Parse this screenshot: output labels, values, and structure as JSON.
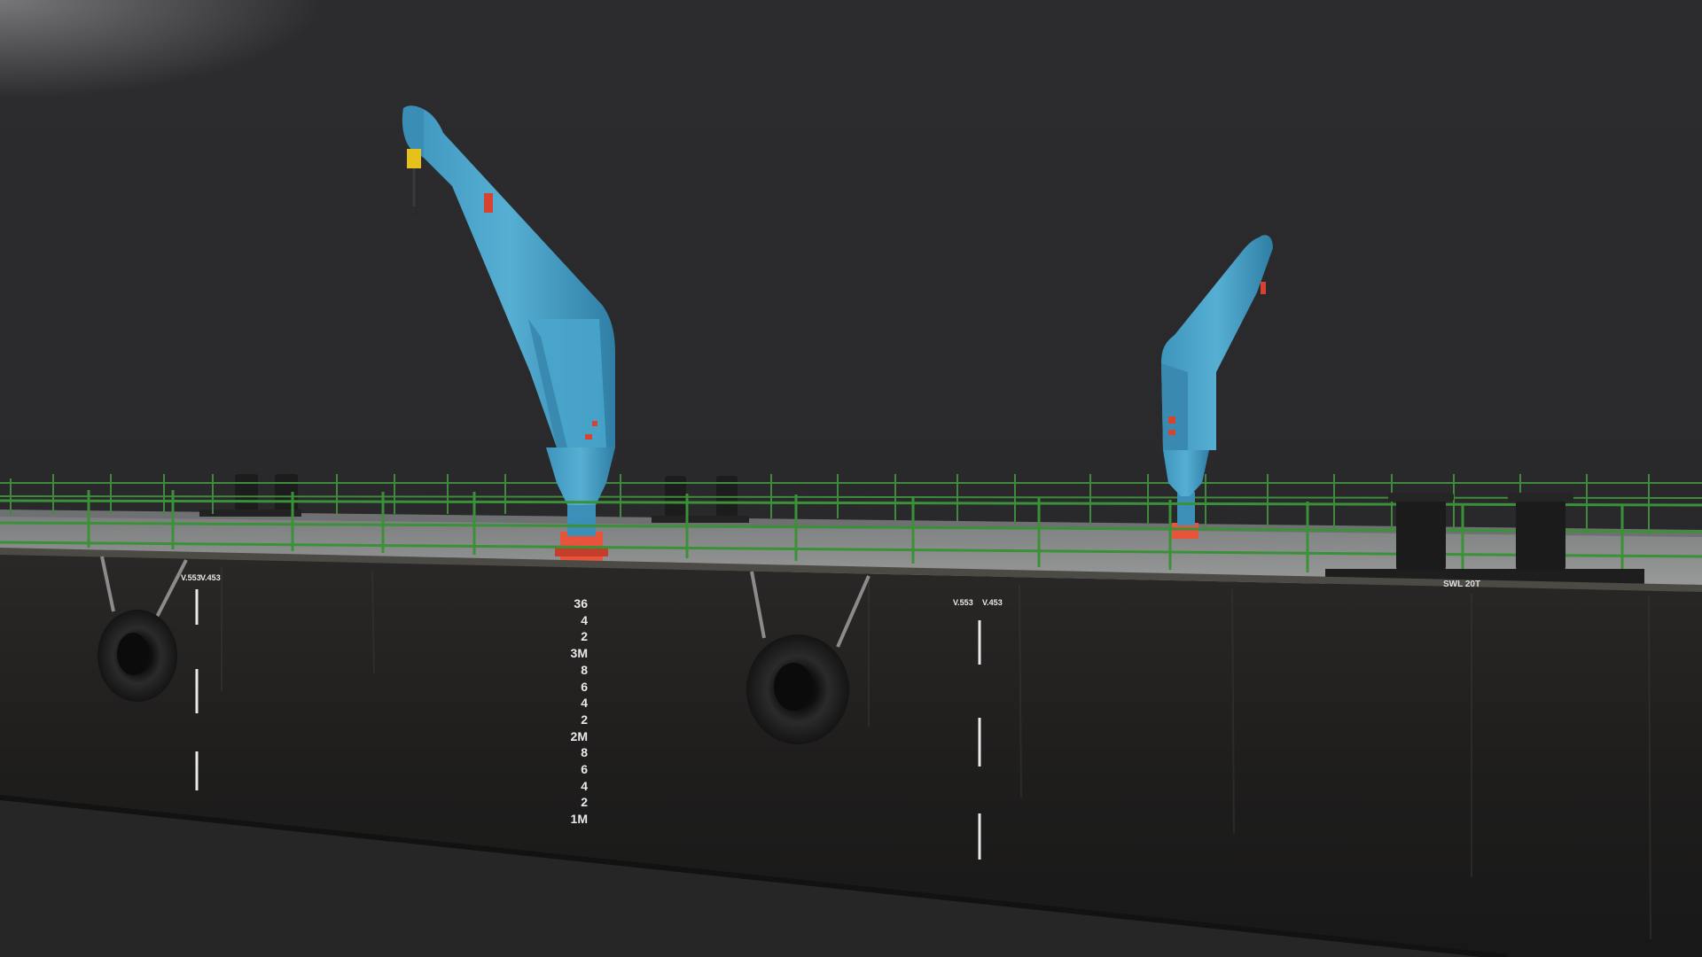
{
  "scene": {
    "subject": "barge-with-two-cranes",
    "colors": {
      "background": "#2a2a2b",
      "hull": "#1f1e1d",
      "deck": "#8e8f8f",
      "crane": "#4ba3c9",
      "crane_base": "#e8533b",
      "railing": "#3f8a3c"
    }
  },
  "hull_marks": {
    "mark_left": {
      "v1": "V.553",
      "v2": "V.453"
    },
    "mark_center": {
      "v1": "V.553",
      "v2": "V.453"
    },
    "draft_scale": [
      "36",
      "4",
      "2",
      "3M",
      "8",
      "6",
      "4",
      "2",
      "2M",
      "8",
      "6",
      "4",
      "2",
      "1M"
    ],
    "bollard_plate": "SWL 20T"
  }
}
